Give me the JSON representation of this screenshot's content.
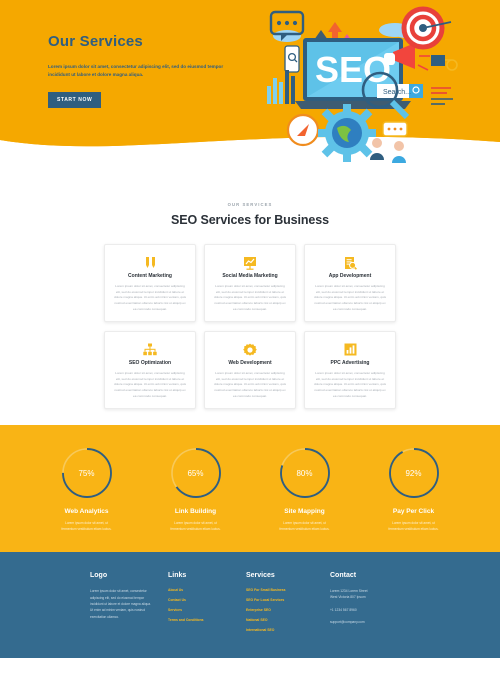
{
  "hero": {
    "title": "Our Services",
    "subtitle": "Lorem ipsum dolor sit amet, consectetur adipiscing elit, sed do eiusmod tempor incididunt ut labore et dolore magna aliqua.",
    "button_label": "START NOW",
    "illustration_name": "seo-laptop-illustration",
    "illustration_word": "SEO",
    "illustration_search_label": "Search...",
    "background_color": "#F5A800",
    "title_color": "#2F5E80",
    "button_color": "#2F5E80"
  },
  "services_section": {
    "eyebrow": "OUR SERVICES",
    "title": "SEO Services for Business",
    "cards": [
      {
        "title": "Content Marketing",
        "icon": "pens-icon",
        "text": "Lorem ipsum dolor sit amet, consectetur adipiscing elit, sed do eiusmod tempor incididunt ut labore et dolore magna aliqua. Ut enim ad minim veniam, quis nostrud exercitation ullamco laboris nisi ut aliquip ex ea commodo consequat."
      },
      {
        "title": "Social Media Marketing",
        "icon": "presentation-chart-icon",
        "text": "Lorem ipsum dolor sit amet, consectetur adipiscing elit, sed do eiusmod tempor incididunt ut labore et dolore magna aliqua. Ut enim ad minim veniam, quis nostrud exercitation ullamco laboris nisi ut aliquip ex ea commodo consequat."
      },
      {
        "title": "App Development",
        "icon": "document-search-icon",
        "text": "Lorem ipsum dolor sit amet, consectetur adipiscing elit, sed do eiusmod tempor incididunt ut labore et dolore magna aliqua. Ut enim ad minim veniam, quis nostrud exercitation ullamco laboris nisi ut aliquip ex ea commodo consequat."
      },
      {
        "title": "SEO Optimization",
        "icon": "sitemap-icon",
        "text": "Lorem ipsum dolor sit amet, consectetur adipiscing elit, sed do eiusmod tempor incididunt ut labore et dolore magna aliqua. Ut enim ad minim veniam, quis nostrud exercitation ullamco laboris nisi ut aliquip ex ea commodo consequat."
      },
      {
        "title": "Web Development",
        "icon": "gear-icon",
        "text": "Lorem ipsum dolor sit amet, consectetur adipiscing elit, sed do eiusmod tempor incididunt ut labore et dolore magna aliqua. Ut enim ad minim veniam, quis nostrud exercitation ullamco laboris nisi ut aliquip ex ea commodo consequat."
      },
      {
        "title": "PPC Advertising",
        "icon": "bar-chart-icon",
        "text": "Lorem ipsum dolor sit amet, consectetur adipiscing elit, sed do eiusmod tempor incididunt ut labore et dolore magna aliqua. Ut enim ad minim veniam, quis nostrud exercitation ullamco laboris nisi ut aliquip ex ea commodo consequat."
      }
    ],
    "icon_color": "#F5B921"
  },
  "stats_section": {
    "background_color": "#F9B415",
    "ring_color": "#2F5E80",
    "ring_track_color": "#F7C95A",
    "items": [
      {
        "percent": "75%",
        "value": 75,
        "label": "Web Analytics",
        "text": "Lorem ipsum dolor sit amet, ut fermentum vestibulum etiam luctus."
      },
      {
        "percent": "65%",
        "value": 65,
        "label": "Link Building",
        "text": "Lorem ipsum dolor sit amet, ut fermentum vestibulum etiam luctus."
      },
      {
        "percent": "80%",
        "value": 80,
        "label": "Site Mapping",
        "text": "Lorem ipsum dolor sit amet, ut fermentum vestibulum etiam luctus."
      },
      {
        "percent": "92%",
        "value": 92,
        "label": "Pay Per Click",
        "text": "Lorem ipsum dolor sit amet, ut fermentum vestibulum etiam luctus."
      }
    ]
  },
  "footer": {
    "background_color": "#346B8F",
    "link_color": "#F5B921",
    "columns": {
      "logo": {
        "heading": "Logo",
        "text": "Lorem ipsum dolor sit amet, consectetur adipiscing elit, sed do eiusmod tempor incididunt ut labore et dolore magna aliqua. Ut enim ad minim veniam, quis nostrud exercitation ullamco."
      },
      "links": {
        "heading": "Links",
        "items": [
          "About Us",
          "Contact Us",
          "Services",
          "Terms and Conditions"
        ]
      },
      "services": {
        "heading": "Services",
        "items": [
          "SEO For Small Business",
          "SEO For Local Services",
          "Enterprise SEO",
          "National SEO",
          "International SEO"
        ]
      },
      "contact": {
        "heading": "Contact",
        "address_line1": "Lorem 1234 Lorem Street",
        "address_line2": "West Victoria 807 Ipsum",
        "phone": "+1 1234 567 8960",
        "email": "support@company.com"
      }
    }
  }
}
